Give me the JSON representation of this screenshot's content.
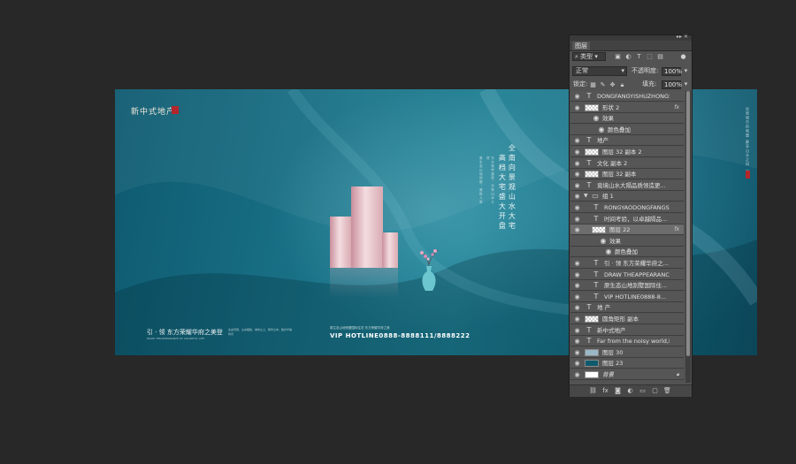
{
  "artwork": {
    "logo_text": "新中式地产",
    "headline_col1": "高档大宅盛大开盘",
    "headline_col2": "全南向景观山水大宅",
    "small_text_col1": "原生态山地别墅，雅致人居",
    "small_text_col2": "东方美学建筑，尽享山水之境",
    "slogan": "引 · 领 东方荣耀华府之美登",
    "slogan_en": "DRAW THEAPPEARANCE OF COLORFUL LIFE",
    "small_block": "生态景观，山水相依，城市之上，繁华之中，独享宁静时光",
    "vip_desc": "原生态山地别墅国际住宅 东方荣耀华府之美",
    "vip": "VIP HOTLINE0888-8888111/8888222",
    "right_vert": "远离城市的喧嚣 静享山水之间 一城"
  },
  "panel": {
    "title": "图层",
    "filter_label": "类型",
    "blend_mode": "正常",
    "opacity_label": "不透明度:",
    "opacity_value": "100%",
    "lock_label": "锁定:",
    "fill_label": "填充:",
    "fill_value": "100%",
    "layers": [
      {
        "name": "DONGFANGYISHUZHONGSH...",
        "type": "text"
      },
      {
        "name": "形状 2",
        "type": "shape",
        "fx": "fx"
      },
      {
        "name": "效果",
        "type": "effects"
      },
      {
        "name": "颜色叠加",
        "type": "effect"
      },
      {
        "name": "地产",
        "type": "text"
      },
      {
        "name": "图层 32 副本 2",
        "type": "pixel"
      },
      {
        "name": "文化 副本 2",
        "type": "text"
      },
      {
        "name": "图层 32 副本",
        "type": "pixel"
      },
      {
        "name": "竟境山水大隔品质领造更...",
        "type": "text"
      },
      {
        "name": "组 1",
        "type": "group"
      },
      {
        "name": "RONGYAODONGFANGSH...",
        "type": "text"
      },
      {
        "name": "时间考验，以卓越隔品...",
        "type": "text"
      },
      {
        "name": "图层 22",
        "type": "pixel",
        "fx": "fx"
      },
      {
        "name": "效果",
        "type": "effects"
      },
      {
        "name": "颜色叠加",
        "type": "effect"
      },
      {
        "name": "引 · 领 东方荣耀华府之...",
        "type": "text"
      },
      {
        "name": "DRAW THEAPPEARANCE...",
        "type": "text"
      },
      {
        "name": "原生态山地别墅国际住...",
        "type": "text"
      },
      {
        "name": "VIP HOTLINE0888-8...",
        "type": "text"
      },
      {
        "name": "地 产",
        "type": "text"
      },
      {
        "name": "圆角矩形 副本",
        "type": "shape"
      },
      {
        "name": "新中式地产",
        "type": "text"
      },
      {
        "name": "Far from the noisy world,Let...",
        "type": "text"
      },
      {
        "name": "图层 30",
        "type": "image"
      },
      {
        "name": "图层 23",
        "type": "teal"
      },
      {
        "name": "背景",
        "type": "background"
      }
    ]
  },
  "colors": {
    "app_bg": "#282828",
    "panel_bg": "#535353",
    "canvas_teal": "#1a7388",
    "seal_red": "#b3262b"
  }
}
